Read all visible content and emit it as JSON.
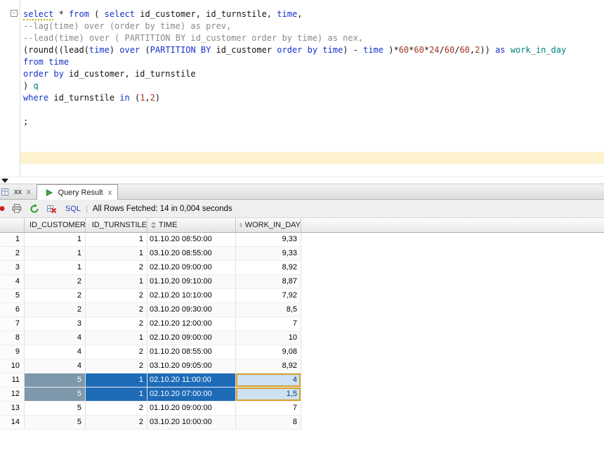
{
  "editor": {
    "lines": [
      {
        "s": [
          [
            "select",
            "kw u"
          ],
          [
            " * ",
            "pl"
          ],
          [
            "from",
            "kw"
          ],
          [
            " ( ",
            "pl"
          ],
          [
            "select",
            "kw"
          ],
          [
            " id_customer, id_turnstile, ",
            "pl"
          ],
          [
            "time",
            "kw"
          ],
          [
            ",",
            "pl"
          ]
        ]
      },
      {
        "s": [
          [
            "--lag(time) over (order by time) as prev,",
            "cm"
          ]
        ]
      },
      {
        "s": [
          [
            "--lead(time) over ( PARTITION BY id_customer order by time) as nex,",
            "cm"
          ]
        ]
      },
      {
        "s": [
          [
            "(round((lead(",
            "pl"
          ],
          [
            "time",
            "kw"
          ],
          [
            ") ",
            "pl"
          ],
          [
            "over",
            "kw"
          ],
          [
            " (",
            "pl"
          ],
          [
            "PARTITION BY",
            "kw"
          ],
          [
            " id_customer ",
            "pl"
          ],
          [
            "order by",
            "kw"
          ],
          [
            " ",
            "pl"
          ],
          [
            "time",
            "kw"
          ],
          [
            ") - ",
            "pl"
          ],
          [
            "time",
            "kw"
          ],
          [
            " )*",
            "pl"
          ],
          [
            "60",
            "num"
          ],
          [
            "*",
            "pl"
          ],
          [
            "60",
            "num"
          ],
          [
            "*",
            "pl"
          ],
          [
            "24",
            "num"
          ],
          [
            "/",
            "pl"
          ],
          [
            "60",
            "num"
          ],
          [
            "/",
            "pl"
          ],
          [
            "60",
            "num"
          ],
          [
            ",",
            "pl"
          ],
          [
            "2",
            "num"
          ],
          [
            ")) ",
            "pl"
          ],
          [
            "as",
            "kw"
          ],
          [
            " ",
            "pl"
          ],
          [
            "work_in_day",
            "al"
          ]
        ]
      },
      {
        "s": [
          [
            "from",
            "kw"
          ],
          [
            " ",
            "pl"
          ],
          [
            "time",
            "kw"
          ]
        ]
      },
      {
        "s": [
          [
            "order by",
            "kw"
          ],
          [
            " id_customer, id_turnstile",
            "pl"
          ]
        ]
      },
      {
        "s": [
          [
            ") ",
            "pl"
          ],
          [
            "q",
            "al"
          ]
        ]
      },
      {
        "s": [
          [
            "where",
            "kw"
          ],
          [
            " id_turnstile ",
            "pl"
          ],
          [
            "in",
            "kw"
          ],
          [
            " (",
            "pl"
          ],
          [
            "1",
            "num"
          ],
          [
            ",",
            "pl"
          ],
          [
            "2",
            "num"
          ],
          [
            ")",
            "pl"
          ]
        ]
      },
      {
        "s": []
      },
      {
        "s": [
          [
            ";",
            "pl"
          ]
        ]
      },
      {
        "s": []
      },
      {
        "s": []
      },
      {
        "s": [],
        "hl": true
      }
    ],
    "fold_marker": "-"
  },
  "tabs": [
    {
      "label": "xx",
      "close": "x"
    },
    {
      "label": "Query Result",
      "close": "x",
      "active": true
    }
  ],
  "toolbar": {
    "icons": [
      "marker-icon",
      "print-icon",
      "refresh-icon",
      "delete-icon"
    ],
    "sql_label": "SQL",
    "separator": "|",
    "status": "All Rows Fetched: 14 in 0,004 seconds"
  },
  "grid": {
    "columns": [
      "ID_CUSTOMER",
      "ID_TURNSTILE",
      "TIME",
      "WORK_IN_DAY"
    ],
    "rows": [
      {
        "n": "1",
        "c": [
          "1",
          "1",
          "01.10.20 08:50:00",
          "9,33"
        ]
      },
      {
        "n": "2",
        "c": [
          "1",
          "1",
          "03.10.20 08:55:00",
          "9,33"
        ]
      },
      {
        "n": "3",
        "c": [
          "1",
          "2",
          "02.10.20 09:00:00",
          "8,92"
        ]
      },
      {
        "n": "4",
        "c": [
          "2",
          "1",
          "01.10.20 09:10:00",
          "8,87"
        ]
      },
      {
        "n": "5",
        "c": [
          "2",
          "2",
          "02.10.20 10:10:00",
          "7,92"
        ]
      },
      {
        "n": "6",
        "c": [
          "2",
          "2",
          "03.10.20 09:30:00",
          "8,5"
        ]
      },
      {
        "n": "7",
        "c": [
          "3",
          "2",
          "02.10.20 12:00:00",
          "7"
        ]
      },
      {
        "n": "8",
        "c": [
          "4",
          "1",
          "02.10.20 09:00:00",
          "10"
        ]
      },
      {
        "n": "9",
        "c": [
          "4",
          "2",
          "01.10.20 08:55:00",
          "9,08"
        ]
      },
      {
        "n": "10",
        "c": [
          "4",
          "2",
          "03.10.20 09:05:00",
          "8,92"
        ]
      },
      {
        "n": "11",
        "c": [
          "5",
          "1",
          "02.10.20 11:00:00",
          "4"
        ],
        "sel": true
      },
      {
        "n": "12",
        "c": [
          "5",
          "1",
          "02.10.20 07:00:00",
          "1,5"
        ],
        "sel": true
      },
      {
        "n": "13",
        "c": [
          "5",
          "2",
          "01.10.20 09:00:00",
          "7"
        ]
      },
      {
        "n": "14",
        "c": [
          "5",
          "2",
          "03.10.20 10:00:00",
          "8"
        ]
      }
    ]
  },
  "colors": {
    "keyword": "#1532c8",
    "comment": "#8a8a8a",
    "number": "#a0341e",
    "alias": "#00817c",
    "current_line": "#fdf3cf",
    "selection_blue": "#1e6bb8",
    "selection_slate": "#7e98ab",
    "focus_cell_bg": "#cde1f2",
    "focus_cell_border": "#d9a22e",
    "play_green": "#3a9e3a",
    "sql_label_blue": "#2742b8",
    "marker_red": "#cc2222"
  }
}
